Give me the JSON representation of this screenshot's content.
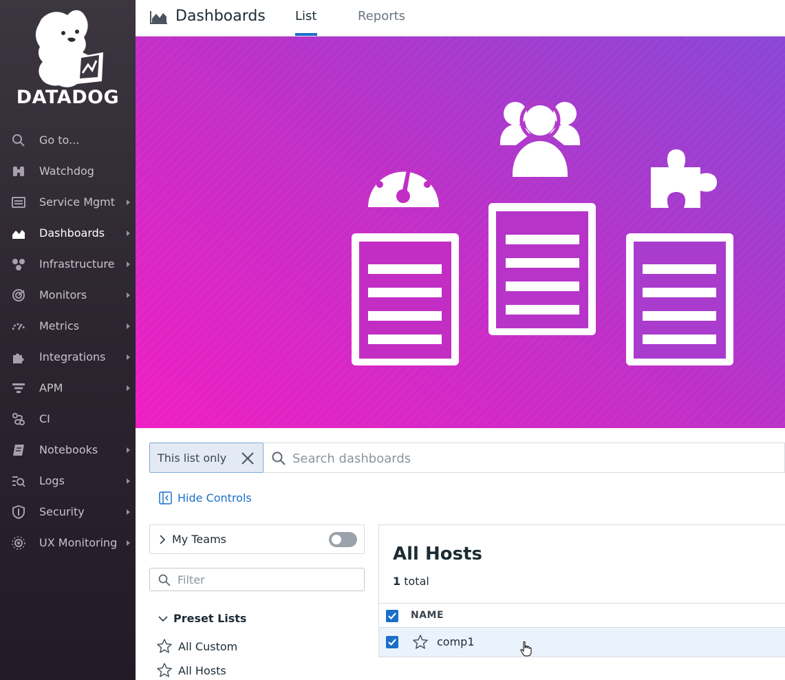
{
  "sidebar": {
    "logo_text": "DATADOG",
    "items": [
      {
        "label": "Go to...",
        "icon": "search-icon",
        "has_submenu": false
      },
      {
        "label": "Watchdog",
        "icon": "binoculars-icon",
        "has_submenu": false
      },
      {
        "label": "Service Mgmt",
        "icon": "service-list-icon",
        "has_submenu": true
      },
      {
        "label": "Dashboards",
        "icon": "area-chart-icon",
        "has_submenu": true,
        "active": true
      },
      {
        "label": "Infrastructure",
        "icon": "hexagons-icon",
        "has_submenu": true
      },
      {
        "label": "Monitors",
        "icon": "radar-icon",
        "has_submenu": true
      },
      {
        "label": "Metrics",
        "icon": "gauge-icon",
        "has_submenu": true
      },
      {
        "label": "Integrations",
        "icon": "puzzle-icon",
        "has_submenu": true
      },
      {
        "label": "APM",
        "icon": "apm-bars-icon",
        "has_submenu": true
      },
      {
        "label": "CI",
        "icon": "pipeline-icon",
        "has_submenu": false
      },
      {
        "label": "Notebooks",
        "icon": "notebook-icon",
        "has_submenu": true
      },
      {
        "label": "Logs",
        "icon": "logs-icon",
        "has_submenu": true
      },
      {
        "label": "Security",
        "icon": "shield-icon",
        "has_submenu": true
      },
      {
        "label": "UX Monitoring",
        "icon": "ux-eye-icon",
        "has_submenu": true
      }
    ]
  },
  "header": {
    "title": "Dashboards",
    "tabs": [
      {
        "label": "List",
        "active": true
      },
      {
        "label": "Reports",
        "active": false
      }
    ]
  },
  "banner": {
    "icons": [
      "gauge-icon",
      "users-icon",
      "puzzle-icon"
    ],
    "gradient_colors": [
      "#ef1fc4",
      "#8a46d6"
    ]
  },
  "search": {
    "chip_label": "This list only",
    "placeholder": "Search dashboards",
    "value": ""
  },
  "controls": {
    "hide_controls_label": "Hide Controls"
  },
  "filters": {
    "my_teams_label": "My Teams",
    "my_teams_enabled": false,
    "filter_placeholder": "Filter",
    "preset_heading": "Preset Lists",
    "preset_items": [
      "All Custom",
      "All Hosts"
    ]
  },
  "list": {
    "title": "All Hosts",
    "count_number": "1",
    "count_suffix": "total",
    "column_name": "NAME",
    "rows": [
      {
        "name": "comp1",
        "checked": true,
        "starred": false
      }
    ]
  },
  "colors": {
    "accent": "#1a6fc9",
    "sidebar_bg": "#2c2530"
  }
}
